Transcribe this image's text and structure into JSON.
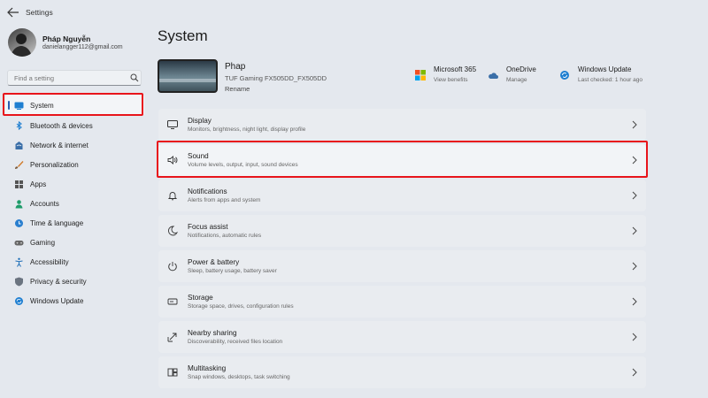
{
  "window": {
    "title": "Settings"
  },
  "profile": {
    "name": "Pháp Nguyễn",
    "email": "danielangger112@gmail.com"
  },
  "search": {
    "placeholder": "Find a setting"
  },
  "sidebar": {
    "items": [
      {
        "label": "System",
        "icon": "system-icon",
        "selected": true
      },
      {
        "label": "Bluetooth & devices",
        "icon": "bluetooth-icon"
      },
      {
        "label": "Network & internet",
        "icon": "network-icon"
      },
      {
        "label": "Personalization",
        "icon": "brush-icon"
      },
      {
        "label": "Apps",
        "icon": "apps-icon"
      },
      {
        "label": "Accounts",
        "icon": "person-icon"
      },
      {
        "label": "Time & language",
        "icon": "globe-clock-icon"
      },
      {
        "label": "Gaming",
        "icon": "gamepad-icon"
      },
      {
        "label": "Accessibility",
        "icon": "accessibility-icon"
      },
      {
        "label": "Privacy & security",
        "icon": "shield-icon"
      },
      {
        "label": "Windows Update",
        "icon": "update-icon"
      }
    ]
  },
  "main": {
    "title": "System",
    "device": {
      "name": "Phap",
      "model": "TUF Gaming FX505DD_FX505DD",
      "rename": "Rename"
    },
    "quick_links": [
      {
        "title": "Microsoft 365",
        "sub": "View benefits",
        "icon": "microsoft-logo-icon"
      },
      {
        "title": "OneDrive",
        "sub": "Manage",
        "icon": "cloud-icon"
      },
      {
        "title": "Windows Update",
        "sub": "Last checked: 1 hour ago",
        "icon": "update-icon"
      }
    ],
    "settings": [
      {
        "title": "Display",
        "sub": "Monitors, brightness, night light, display profile",
        "icon": "monitor-icon"
      },
      {
        "title": "Sound",
        "sub": "Volume levels, output, input, sound devices",
        "icon": "speaker-icon"
      },
      {
        "title": "Notifications",
        "sub": "Alerts from apps and system",
        "icon": "bell-icon"
      },
      {
        "title": "Focus assist",
        "sub": "Notifications, automatic rules",
        "icon": "moon-icon"
      },
      {
        "title": "Power & battery",
        "sub": "Sleep, battery usage, battery saver",
        "icon": "power-icon"
      },
      {
        "title": "Storage",
        "sub": "Storage space, drives, configuration rules",
        "icon": "storage-icon"
      },
      {
        "title": "Nearby sharing",
        "sub": "Discoverability, received files location",
        "icon": "share-icon"
      },
      {
        "title": "Multitasking",
        "sub": "Snap windows, desktops, task switching",
        "icon": "multitask-icon"
      }
    ]
  },
  "colors": {
    "highlight": "#e8141b",
    "accent": "#2a5db0",
    "background": "#e4e8ee"
  }
}
